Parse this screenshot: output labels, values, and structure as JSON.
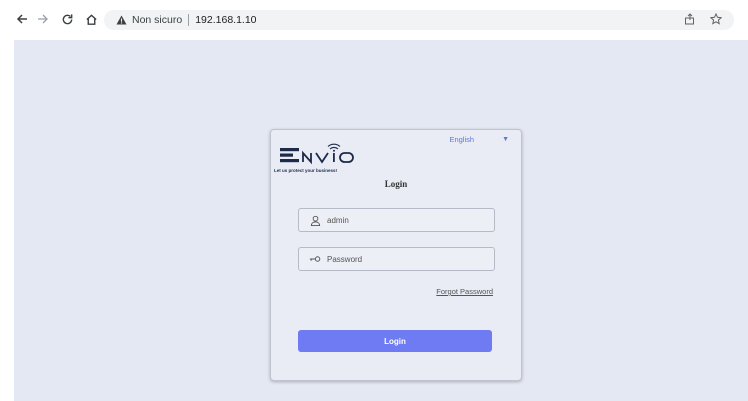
{
  "browser": {
    "security_label": "Non sicuro",
    "url": "192.168.1.10"
  },
  "login": {
    "language": "English",
    "brand_tagline": "Let us protect your business!",
    "title": "Login",
    "username_value": "admin",
    "password_placeholder": "Password",
    "forgot_password": "Forgot Password",
    "login_button": "Login"
  },
  "colors": {
    "accent": "#6f7bf2",
    "link": "#5a7ad6",
    "page_bg": "#e4e8f3"
  }
}
